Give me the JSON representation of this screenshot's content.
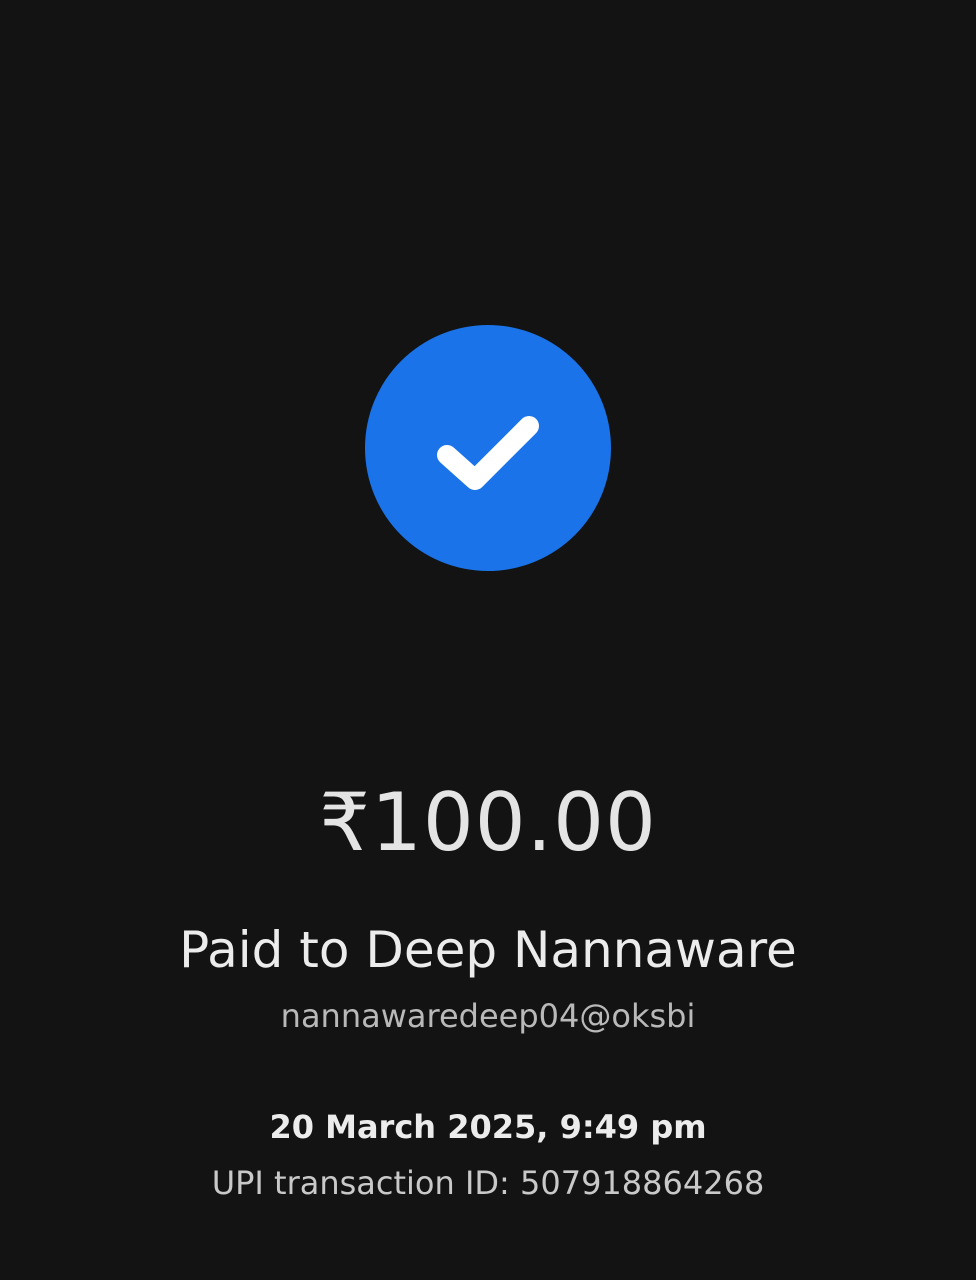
{
  "status": {
    "icon": "checkmark-icon",
    "accent_color": "#1a73e8"
  },
  "payment": {
    "amount": "₹100.00",
    "paid_to": "Paid to Deep Nannaware",
    "payee_upi": "nannawaredeep04@oksbi",
    "datetime": "20 March 2025, 9:49 pm",
    "transaction_id": "UPI transaction ID: 507918864268"
  }
}
